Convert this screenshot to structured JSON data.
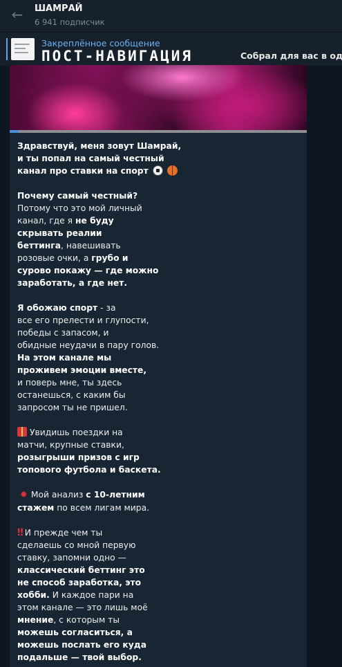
{
  "channel": {
    "title": "ШАМРАЙ",
    "subscribers": "6 941 подписчик"
  },
  "pinned": {
    "label": "Закреплённое сообщение",
    "title": "ПОСТ-НАВИГАЦИЯ",
    "preview": "Собрал для вас в одно"
  },
  "message": {
    "image": {
      "progress_fraction": 0.03
    },
    "intro": [
      "Здравствуй, меня зовут Шамрай,",
      "и ты попал на самый честный",
      "канал про ставки на спорт"
    ],
    "why": {
      "q": "Почему самый честный?",
      "l1": "Потому что это мой личный",
      "l2a": "канал, где я ",
      "l2b": "не буду",
      "l3": "скрывать реалии",
      "l4a": "беттинга",
      "l4b": ", навешивать",
      "l5a": "розовые очки, а ",
      "l5b": "грубо и",
      "l6": "сурово покажу — где можно",
      "l7": "заработать, а где нет."
    },
    "love": {
      "l1a": "Я обожаю спорт",
      "l1b": " - за",
      "l2": "все его прелести и глупости,",
      "l3": "победы с запасом, и",
      "l4": "обидные неудачи в пару голов.",
      "l5": "На этом канале мы",
      "l6": "проживем эмоции вместе,",
      "l7": "и поверь мне, ты здесь",
      "l8": "останешься, с каким бы",
      "l9": "запросом ты не пришел."
    },
    "trips": {
      "l1": "Увидишь поездки на",
      "l2": "матчи, крупные ставки,",
      "l3": "розыгрыши призов с игр",
      "l4": "топового футбола и баскета."
    },
    "analysis": {
      "l1a": "Мой анализ ",
      "l1b": "с 10-летним",
      "l2a": "стажем",
      "l2b": " по всем лигам мира."
    },
    "before": {
      "l1": "И прежде чем ты",
      "l2": "сделаешь со мной первую",
      "l3": "ставку, запомни одно —",
      "l4": "классический беттинг это",
      "l5": "не способ заработка, это",
      "l6a": "хобби.",
      "l6b": " И каждое пари на",
      "l7": "этом канале — это лишь моё",
      "l8a": "мнение",
      "l8b": ", с которым ты",
      "l9": "можешь согласиться, а",
      "l10": "можешь послать его куда",
      "l11": "подальше — твой выбор."
    }
  },
  "icons": {
    "back": "arrow-left-icon",
    "soccer": "soccer-ball-icon",
    "basketball": "basketball-icon",
    "gift": "gift-icon",
    "star": "red-star-icon",
    "exclamation": "double-exclamation-icon"
  },
  "colors": {
    "background": "#0e1621",
    "header": "#17212b",
    "bubble": "#182533",
    "accent": "#6ab2f2"
  }
}
